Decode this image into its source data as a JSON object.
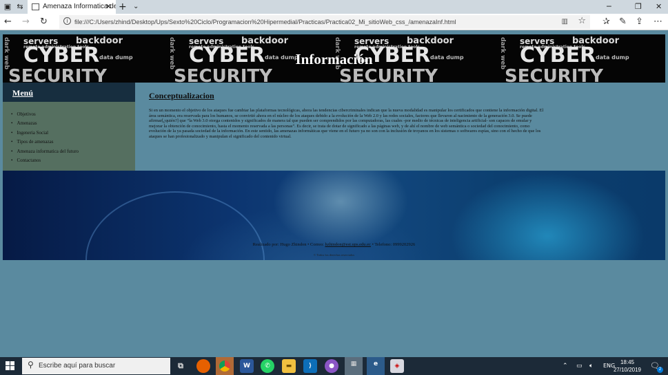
{
  "browser": {
    "tab_title": "Amenaza Informatica de",
    "tab_close": "✕",
    "new_tab": "+",
    "tab_menu": "⌄",
    "url": "file:///C:/Users/zhind/Desktop/Ups/Sexto%20Ciclo/Programacion%20Hipermedial/Practicas/Practica02_Mi_sitioWeb_css_/amenazaInf.html"
  },
  "banner": {
    "title": "Información",
    "words": {
      "cyber": "CYBER",
      "security": "SECURITY",
      "backdoor": "backdoor",
      "servers": "servers",
      "remote": "remote administration tools",
      "data": "data dump",
      "dark": "dark web"
    }
  },
  "menu": {
    "title": "Menú",
    "items": [
      {
        "label": "Objetivos"
      },
      {
        "label": "Amenazas"
      },
      {
        "label": "Ingeneria Social"
      },
      {
        "label": "Tipos de amenazas"
      },
      {
        "label": "Amenaza informatica del futuro"
      },
      {
        "label": "Contactanos"
      }
    ]
  },
  "content": {
    "heading": "Conceptualizacion",
    "paragraph": "Si en un momento el objetivo de los ataques fue cambiar las plataformas tecnológicas, ahora las tendencias cibercriminales indican que la nueva modalidad es manipular los certificados que contiene la información digital. El área semántica, era reservada para los humanos, se convirtió ahora en el núcleo de los ataques debido a la evolución de la Web 2.0 y las redes sociales, factores que llevaron al nacimiento de la generación 3.0. Se puede afirmar[¿quién?] que “la Web 3.0 otorga contenidos y significados de manera tal que pueden ser comprendidos por las computadoras, las cuales -por medio de técnicas de inteligencia artificial- son capaces de emular y mejorar la obtención de conocimiento, hasta el momento reservada a las personas”. Es decir, se trata de dotar de significado a las páginas web, y de ahí el nombre de web semántica o sociedad del conocimiento, como evolución de la ya pasada sociedad de la información. En este sentido, las amenazas informáticas que viene en el futuro ya no son con la inclusión de troyanos en los sistemas o softwares espías, sino con el hecho de que los ataques se han profesionalizado y manipulan el significado del contenido virtual."
  },
  "footer": {
    "prefix": "Realizado por: Hugo Zhindon • Correo: ",
    "email": "hzhindon@est.ups.edu.ec",
    "suffix": " • Telefono: 0999202926",
    "copyright": "© Todos los derechos reservados"
  },
  "taskbar": {
    "search_placeholder": "Escribe aquí para buscar",
    "language": "ENG",
    "time": "18:45",
    "date": "27/10/2019",
    "notification_count": "2"
  }
}
